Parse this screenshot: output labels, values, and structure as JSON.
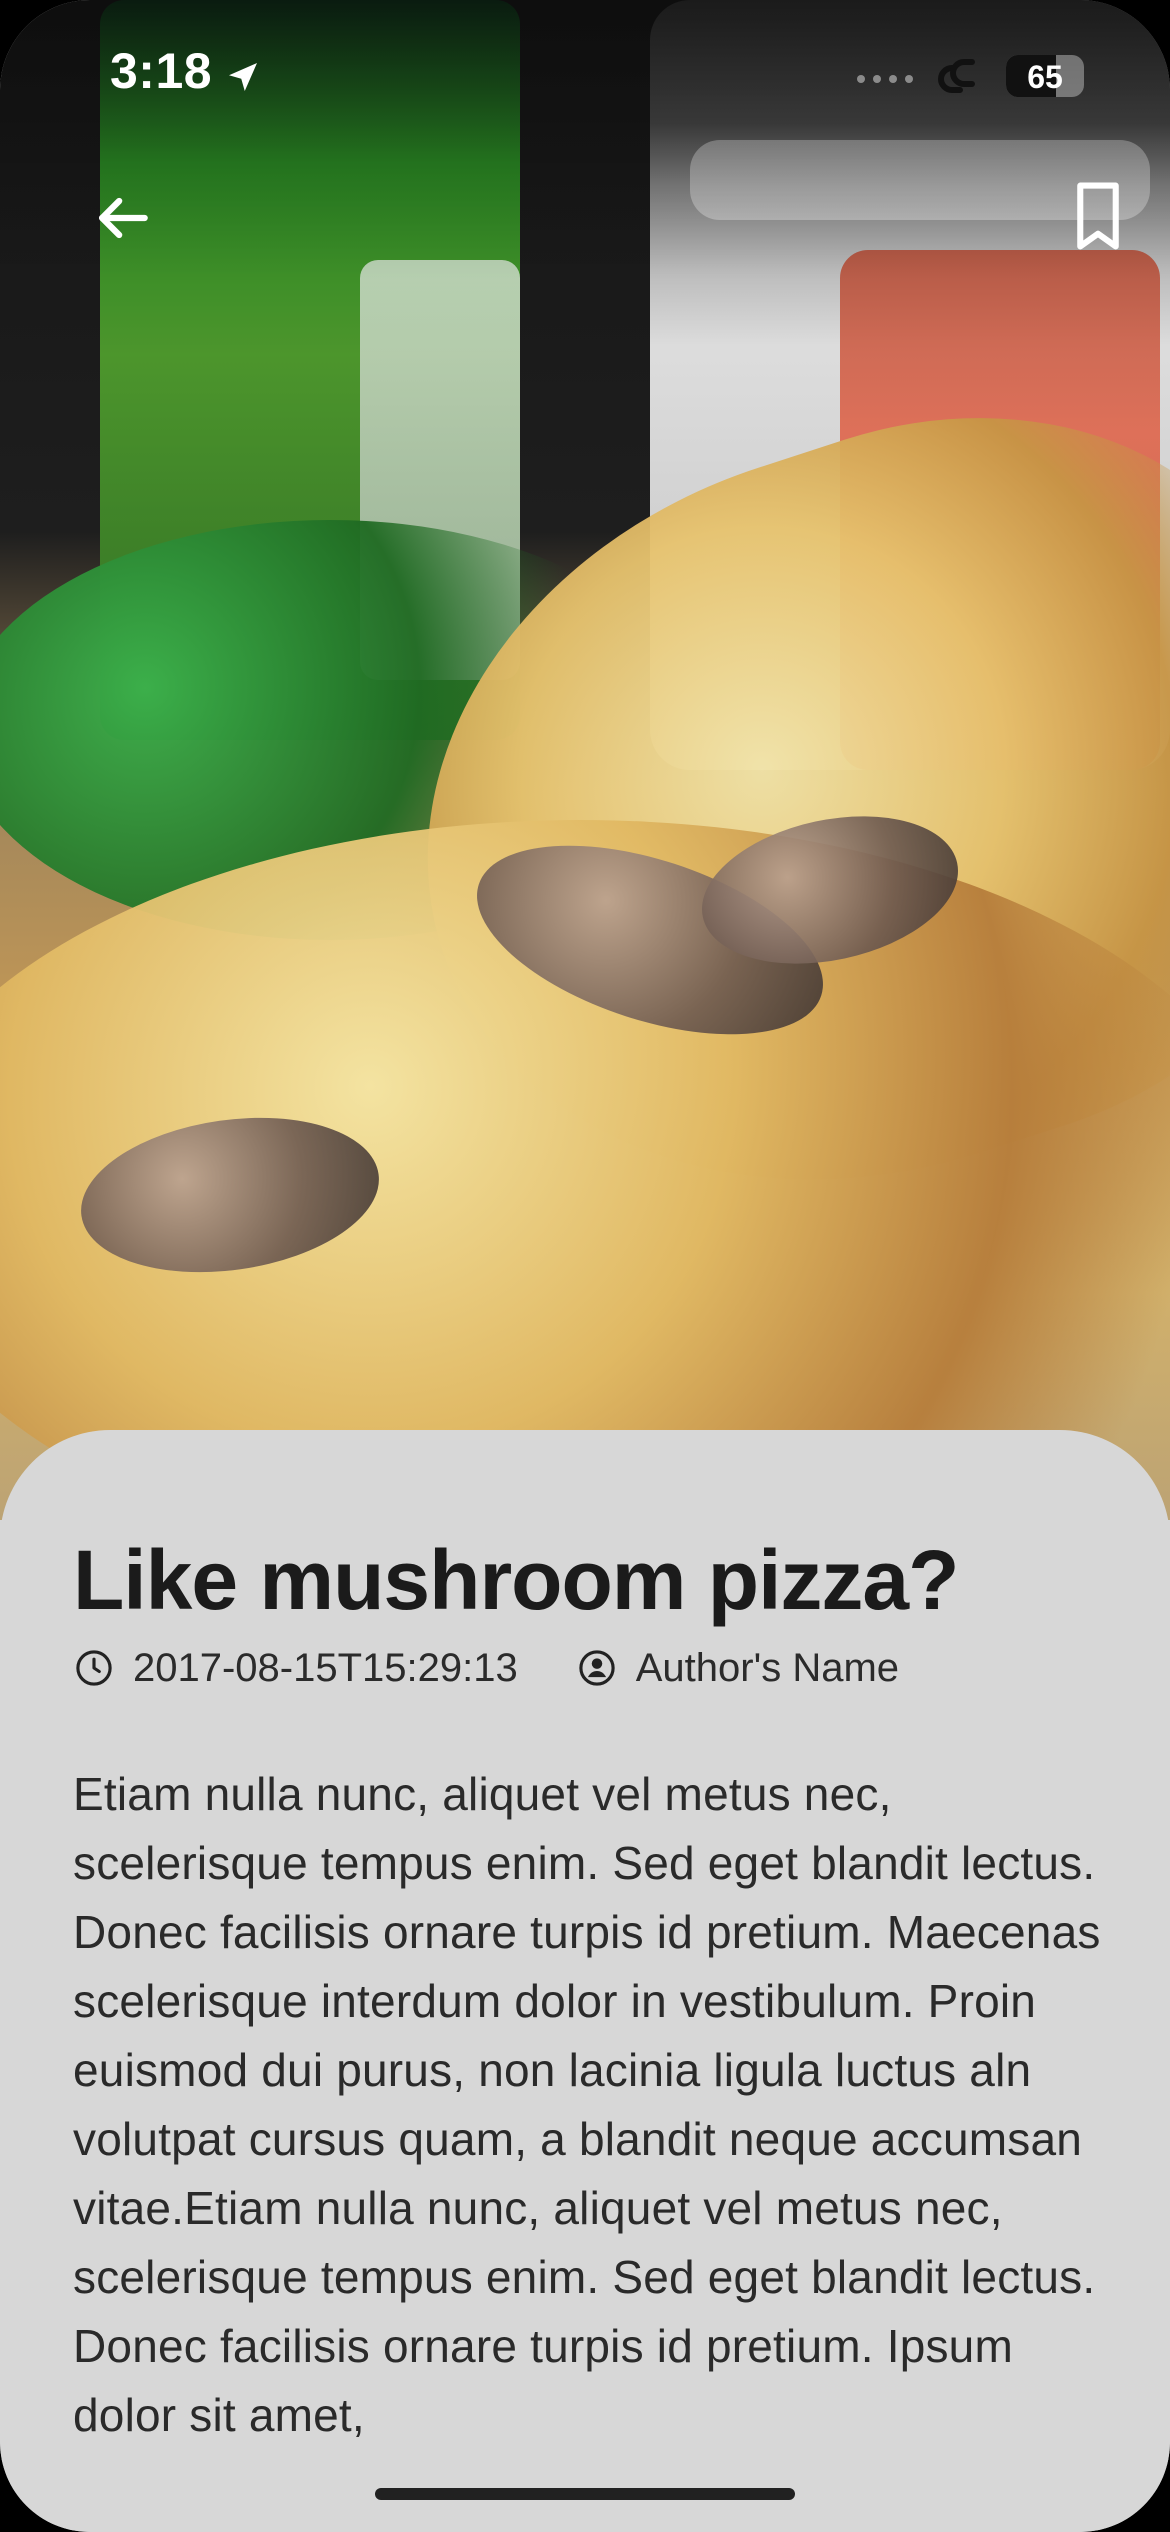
{
  "status_bar": {
    "time": "3:18",
    "battery_level": "65"
  },
  "navigation": {
    "back_icon": "arrow-left-icon",
    "bookmark_icon": "bookmark-icon"
  },
  "article": {
    "title": "Like mushroom pizza?",
    "timestamp": "2017-08-15T15:29:13",
    "author": "Author's Name",
    "body": "Etiam nulla nunc, aliquet vel metus nec, scelerisque tempus enim. Sed eget blandit lectus. Donec facilisis ornare turpis id pretium. Maecenas scelerisque interdum dolor in vestibulum. Proin euismod dui purus, non lacinia ligula luctus aln volutpat cursus quam, a blandit neque accumsan vitae.Etiam nulla nunc, aliquet vel metus nec, scelerisque tempus enim. Sed eget blandit lectus. Donec facilisis ornare turpis id pretium. Ipsum dolor sit amet,"
  },
  "icons": {
    "time_icon": "clock-icon",
    "author_icon": "user-circle-icon",
    "location_icon": "location-arrow-icon",
    "link_icon": "link-icon",
    "battery_icon": "battery-icon"
  },
  "colors": {
    "sheet_background": "#d7d7d7",
    "title": "#1b1b1b",
    "body": "#2a2a2a",
    "icon_light": "#ffffff",
    "icon_dark": "#222222"
  }
}
